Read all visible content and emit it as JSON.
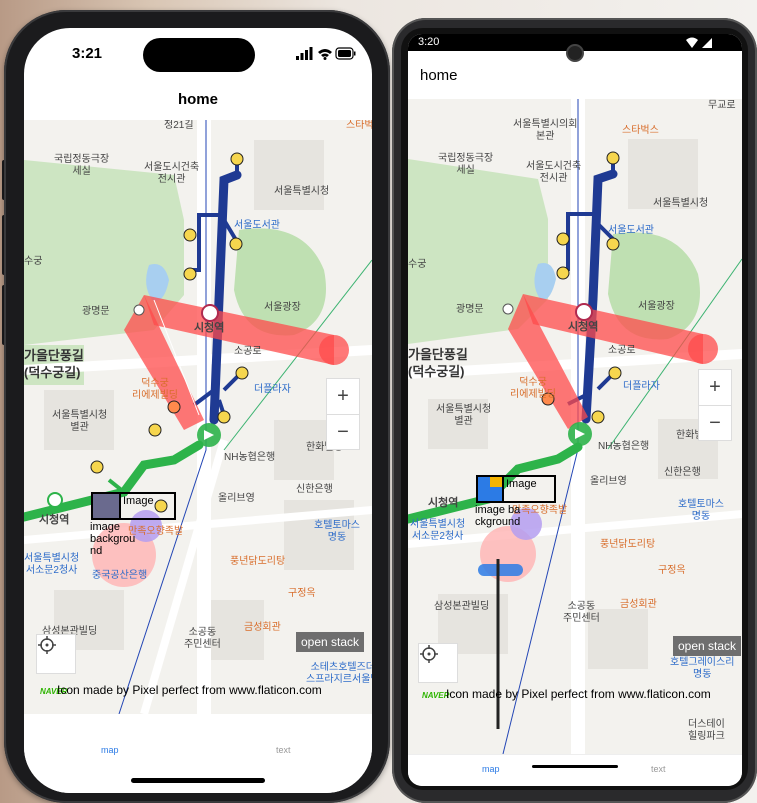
{
  "ios": {
    "status_time": "3:21",
    "nav_title": "home",
    "tabs": [
      {
        "label": "map"
      },
      {
        "label": "text"
      }
    ],
    "open_stack_label": "open stack",
    "credit": "Icon made by Pixel perfect from www.flaticon.com",
    "naver_logo": "NAVER",
    "overlay": {
      "image_label": "Image",
      "bg_label": "image\nbackgrou\nnd"
    },
    "zoom": {
      "plus": "+",
      "minus": "−"
    }
  },
  "android": {
    "status_time": "3:20",
    "nav_title": "home",
    "tabs": [
      {
        "label": "map"
      },
      {
        "label": "text"
      }
    ],
    "open_stack_label": "open stack",
    "credit": "Icon made by Pixel perfect from www.flaticon.com",
    "naver_logo": "NAVER",
    "overlay": {
      "image_label": "Image",
      "bg_label": "image ba\nckground"
    },
    "zoom": {
      "plus": "+",
      "minus": "−"
    }
  },
  "map_labels": {
    "cityhall": "서울특별시청",
    "library": "서울도서관",
    "plaza": "서울광장",
    "station": "시청역",
    "gwangmyeongmun": "광명문",
    "deoksu_road": "덕수궁길",
    "deoksu_road2": "(덕수궁길)",
    "gaeul": "가을단풍길",
    "deoksugung": "수궁",
    "theater": "국립정동극장\n세실",
    "building_center": "서울도시건축\n전시관",
    "residence": "덕수궁\n리에제빌딩",
    "seoul_hall": "서울특별시청\n별관",
    "plaza_hotel": "더플라자",
    "nh": "NH농협은행",
    "hanwha": "한화빌딩",
    "shinhan": "신한은행",
    "olive": "올리브영",
    "hotel_thomas": "호텔토마스\n명동",
    "pungnyeon": "풍년닭도리탕",
    "gujeong": "구정옥",
    "samsung": "삼성본관빌딩",
    "sogong": "소공동\n주민센터",
    "geumseong": "금성회관",
    "sofitel": "소테츠호텔즈더\n스프라지르서울명",
    "seoul_city2": "서울특별시청\n서소문2청사",
    "jungguk": "중국공산은행",
    "station2": "시청역",
    "starbucks": "스타벅스",
    "mugyo": "무교로",
    "sogong_ro": "소공로",
    "seoul_city_council": "서울특별시의회\n본관",
    "hotel_graces": "호텔그레이스리\n명동",
    "desteii": "더스테이\n힐링파크",
    "minjok": "만족오향족발",
    "jeong21": "정21길"
  },
  "colors": {
    "line1": "#1f3a93",
    "line2": "#2db34a",
    "accent_red": "#ff4b4b",
    "accent_purple": "#9b7fe8",
    "open_stack_bg": "#6e6e6e",
    "tab_active": "#2c7be5"
  }
}
